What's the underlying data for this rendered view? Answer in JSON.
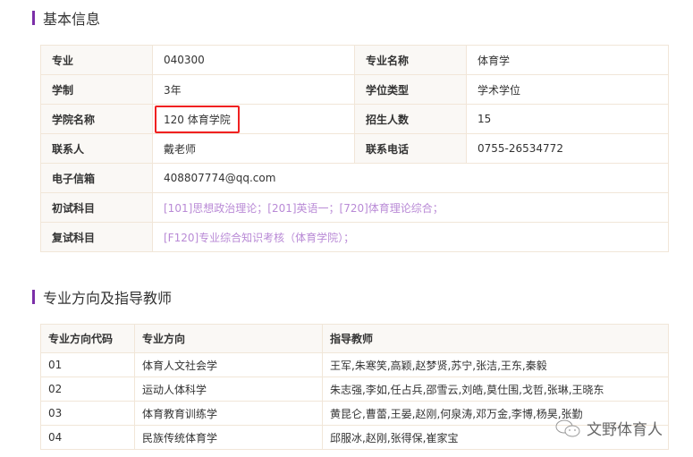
{
  "basic": {
    "title": "基本信息",
    "rows": [
      [
        {
          "l": "专业",
          "v": "040300"
        },
        {
          "l": "专业名称",
          "v": "体育学"
        }
      ],
      [
        {
          "l": "学制",
          "v": "3年"
        },
        {
          "l": "学位类型",
          "v": "学术学位"
        }
      ],
      [
        {
          "l": "学院名称",
          "v": "120 体育学院"
        },
        {
          "l": "招生人数",
          "v": "15"
        }
      ],
      [
        {
          "l": "联系人",
          "v": "戴老师"
        },
        {
          "l": "联系电话",
          "v": "0755-26534772"
        }
      ]
    ],
    "email_label": "电子信箱",
    "email": "408807774@qq.com",
    "exam1_label": "初试科目",
    "exam1": "[101]思想政治理论；[201]英语一；[720]体育理论综合；",
    "exam2_label": "复试科目",
    "exam2": "[F120]专业综合知识考核（体育学院）；"
  },
  "directions": {
    "title": "专业方向及指导教师",
    "headers": [
      "专业方向代码",
      "专业方向",
      "指导教师"
    ],
    "rows": [
      [
        "01",
        "体育人文社会学",
        "王军,朱寒笑,高颖,赵梦贤,苏宁,张洁,王东,秦毅"
      ],
      [
        "02",
        "运动人体科学",
        "朱志强,李如,任占兵,邵雪云,刘皓,莫仕围,戈哲,张琳,王晓东"
      ],
      [
        "03",
        "体育教育训练学",
        "黄昆仑,曹蕾,王晏,赵刚,何泉涛,邓万金,李博,杨昊,张勤"
      ],
      [
        "04",
        "民族传统体育学",
        "邱服冰,赵刚,张得保,崔家宝"
      ]
    ]
  },
  "watermark": "文野体育人",
  "colors": {
    "accent": "#7b2fa8",
    "highlight": "#f02020",
    "link": "#b98ad6"
  }
}
